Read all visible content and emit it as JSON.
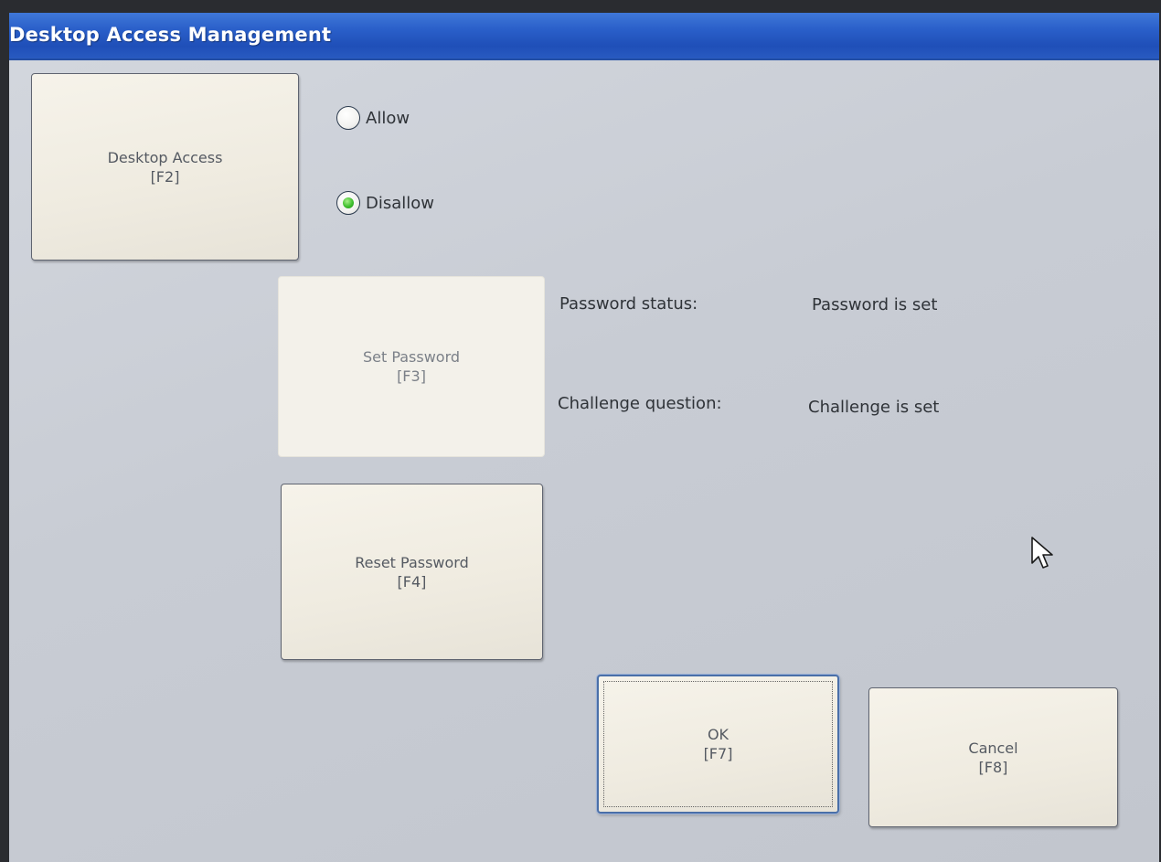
{
  "window": {
    "title": "Desktop Access Management"
  },
  "desktop_access": {
    "label": "Desktop Access",
    "key": "[F2]",
    "options": [
      {
        "label": "Allow",
        "selected": false
      },
      {
        "label": "Disallow",
        "selected": true
      }
    ]
  },
  "password": {
    "set_label": "Set Password",
    "set_key": "[F3]",
    "set_enabled": false,
    "reset_label": "Reset Password",
    "reset_key": "[F4]",
    "status_label": "Password status:",
    "status_value": "Password is set",
    "challenge_label": "Challenge question:",
    "challenge_value": "Challenge is set"
  },
  "actions": {
    "ok_label": "OK",
    "ok_key": "[F7]",
    "cancel_label": "Cancel",
    "cancel_key": "[F8]"
  },
  "colors": {
    "titlebar": "#2a5fc9",
    "window_bg": "#c8ccd4",
    "button_face": "#efebe0",
    "radio_selected": "#3fbf2e"
  },
  "icons": {
    "cursor": "mouse-pointer-icon"
  }
}
